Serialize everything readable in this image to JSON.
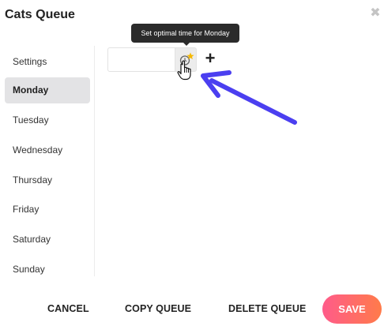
{
  "dialog": {
    "title": "Cats Queue",
    "close_glyph": "✖"
  },
  "sidebar": {
    "items": [
      {
        "label": "Settings",
        "active": false
      },
      {
        "label": "Monday",
        "active": true
      },
      {
        "label": "Tuesday",
        "active": false
      },
      {
        "label": "Wednesday",
        "active": false
      },
      {
        "label": "Thursday",
        "active": false
      },
      {
        "label": "Friday",
        "active": false
      },
      {
        "label": "Saturday",
        "active": false
      },
      {
        "label": "Sunday",
        "active": false
      }
    ]
  },
  "editor": {
    "time_value": "",
    "plus_label": "+",
    "tooltip": "Set optimal time for Monday"
  },
  "footer": {
    "cancel_label": "CANCEL",
    "copy_label": "COPY QUEUE",
    "delete_label": "DELETE QUEUE",
    "save_label": "SAVE"
  },
  "colors": {
    "accent_gradient_start": "#ff5b8a",
    "accent_gradient_end": "#ff7b4a",
    "annotation_arrow": "#4b3ff0",
    "star": "#f5b800"
  },
  "icons": {
    "optimal_time": "clock-star-icon",
    "add": "plus-icon",
    "close": "close-icon",
    "cursor": "hand-pointer-icon"
  }
}
